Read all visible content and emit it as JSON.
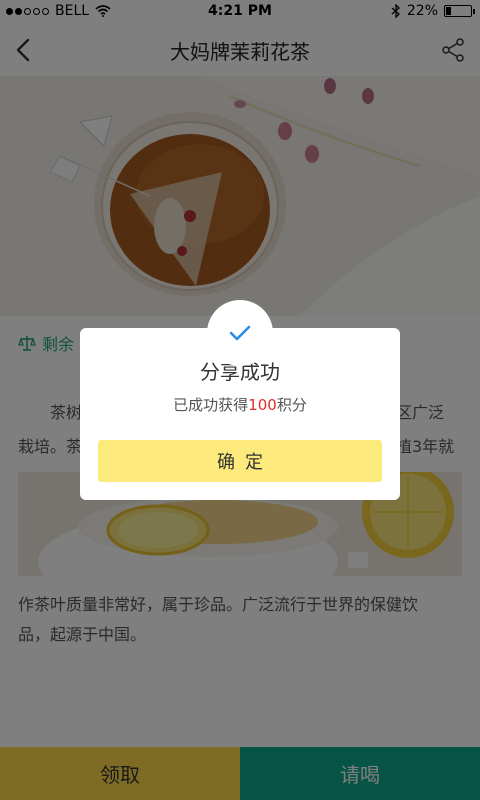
{
  "status_bar": {
    "carrier": "BELL",
    "time": "4:21 PM",
    "battery": "22%",
    "battery_level": 0.22
  },
  "nav": {
    "title": "大妈牌茉莉花茶"
  },
  "article": {
    "remaining_prefix": "剩余",
    "para1_line1": "茶树",
    "para1_line1_tail": "地区广泛",
    "para1_line2": "栽培。茶",
    "para1_line2_tail": "植3年就",
    "para2_line1": "作茶叶质量非常好，属于珍品。广泛流行于世界的保健饮",
    "para2_line2": "品，起源于中国。"
  },
  "bottom": {
    "receive_label": "领取",
    "treat_label": "请喝"
  },
  "dialog": {
    "title": "分享成功",
    "message_prefix": "已成功获得",
    "points": "100",
    "message_suffix": "积分",
    "confirm_label": "确定"
  },
  "colors": {
    "accent_green": "#0aa88a",
    "accent_yellow": "#fdd94b",
    "points_red": "#e52b2b"
  }
}
